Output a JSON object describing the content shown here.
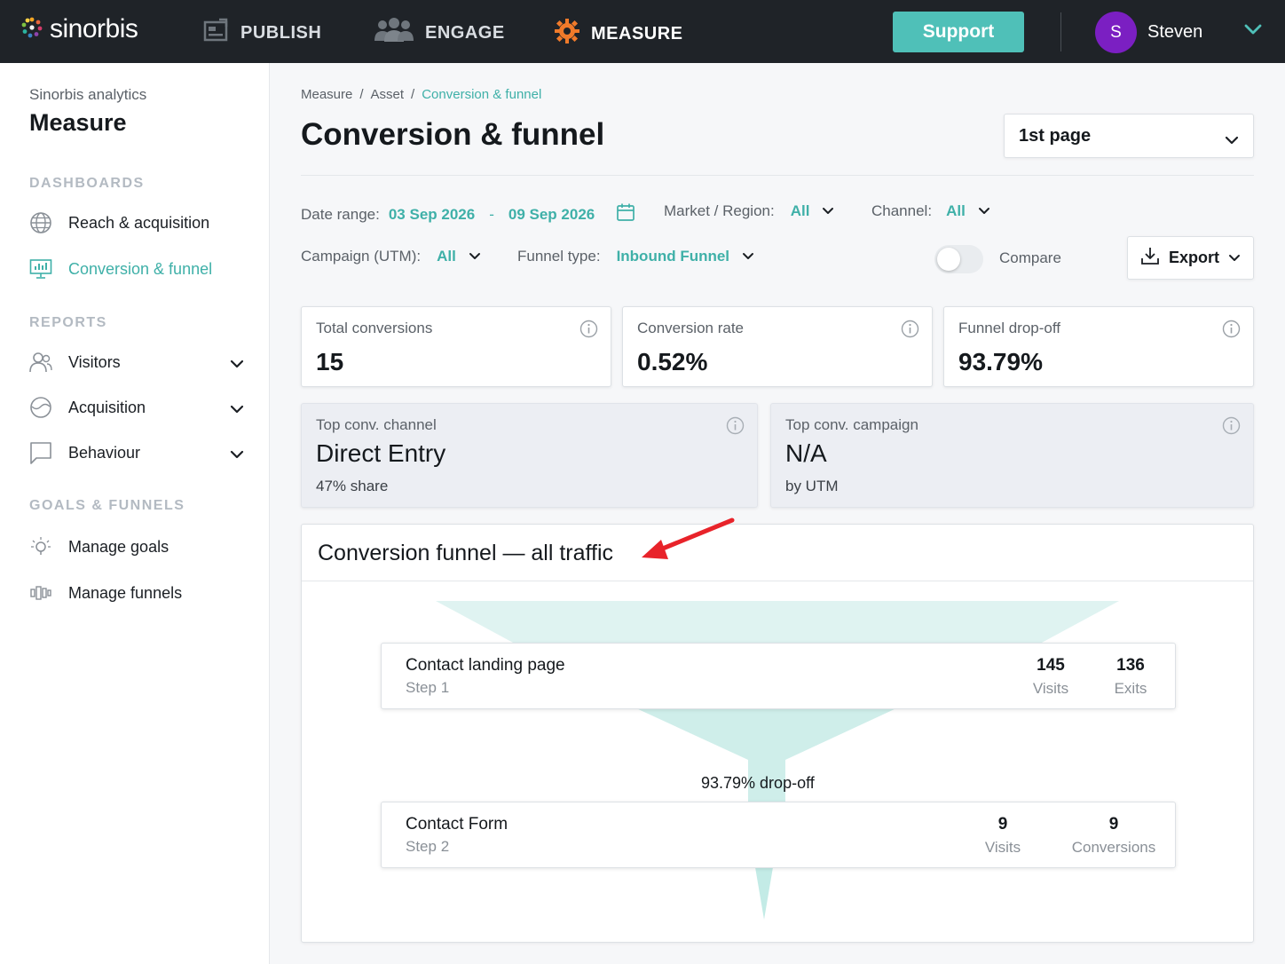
{
  "topbar": {
    "brand": "sinorbis",
    "nav": [
      "PUBLISH",
      "ENGAGE",
      "MEASURE"
    ],
    "support_label": "Support",
    "avatar_initial": "S",
    "user_name": "Steven"
  },
  "sidebar": {
    "subtitle": "Sinorbis analytics",
    "title": "Measure",
    "sections": [
      "DASHBOARDS",
      "REPORTS",
      "GOALS & FUNNELS"
    ],
    "dashboards": [
      "Reach & acquisition",
      "Conversion & funnel"
    ],
    "reports": [
      "Visitors",
      "Acquisition",
      "Behaviour"
    ],
    "goals": [
      "Manage goals",
      "Manage funnels"
    ],
    "active_item": "Conversion & funnel"
  },
  "breadcrumb": [
    "Measure",
    "/",
    "Asset",
    "/",
    "Conversion & funnel"
  ],
  "page": {
    "title": "Conversion & funnel",
    "page_select": "1st page"
  },
  "filters": {
    "date_label": "Date range:",
    "date_from": "03 Sep 2026",
    "date_sep": "-",
    "date_to": "09 Sep 2026",
    "market_label": "Market / Region:",
    "market_value": "All",
    "channel_label": "Channel:",
    "channel_value": "All",
    "campaign_label": "Campaign (UTM):",
    "campaign_value": "All",
    "funnel_label": "Funnel type:",
    "funnel_value": "Inbound Funnel",
    "compare_label": "Compare",
    "compare_on": false,
    "export_label": "Export"
  },
  "kpis": [
    {
      "label": "Total conversions",
      "value": "15"
    },
    {
      "label": "Conversion rate",
      "value": "0.52%"
    },
    {
      "label": "Funnel drop-off",
      "value": "93.79%"
    }
  ],
  "highlights": [
    {
      "label": "Top conv. channel",
      "value": "Direct Entry",
      "sub": "47% share"
    },
    {
      "label": "Top conv. campaign",
      "value": "N/A",
      "sub": "by UTM"
    }
  ],
  "funnel": {
    "title": "Conversion funnel — all traffic",
    "steps": [
      {
        "name": "Contact landing page",
        "step": "Step 1",
        "m1_value": "145",
        "m1_label": "Visits",
        "m2_value": "136",
        "m2_label": "Exits"
      },
      {
        "name": "Contact Form",
        "step": "Step 2",
        "m1_value": "9",
        "m1_label": "Visits",
        "m2_value": "9",
        "m2_label": "Conversions"
      }
    ],
    "dropoff": "93.79% drop-off"
  },
  "colors": {
    "accent": "#3fb0a8",
    "support": "#4fc0b8",
    "topbar": "#1f2328",
    "avatar": "#7b1fc2",
    "funnel_fill": "#dff3f1",
    "annotation_arrow": "#e8232a"
  }
}
